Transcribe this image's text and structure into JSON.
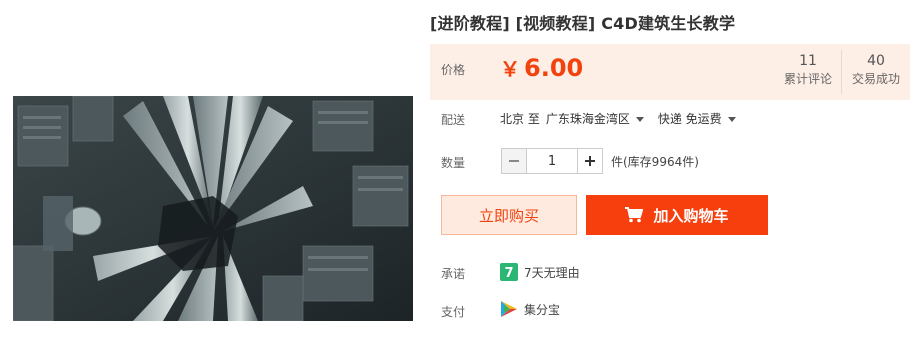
{
  "product": {
    "title": "[进阶教程] [视频教程] C4D建筑生长教学",
    "image_icon": "city-aerial-photo"
  },
  "price": {
    "label": "价格",
    "currency": "￥",
    "value": "6.00",
    "color": "#f2430f"
  },
  "stats": {
    "reviews_count": "11",
    "reviews_label": "累计评论",
    "deals_count": "40",
    "deals_label": "交易成功"
  },
  "shipping": {
    "label": "配送",
    "from": "北京 至",
    "to": "广东珠海金湾区",
    "method": "快递 免运费"
  },
  "quantity": {
    "label": "数量",
    "value": "1",
    "stock": "件(库存9964件)"
  },
  "actions": {
    "buy_now": "立即购买",
    "add_to_cart": "加入购物车",
    "cart_icon": "cart-icon",
    "accent": "#f63f0c"
  },
  "promise": {
    "label": "承诺",
    "text": "7天无理由",
    "icon_text": "7"
  },
  "payment": {
    "label": "支付",
    "text": "集分宝"
  }
}
